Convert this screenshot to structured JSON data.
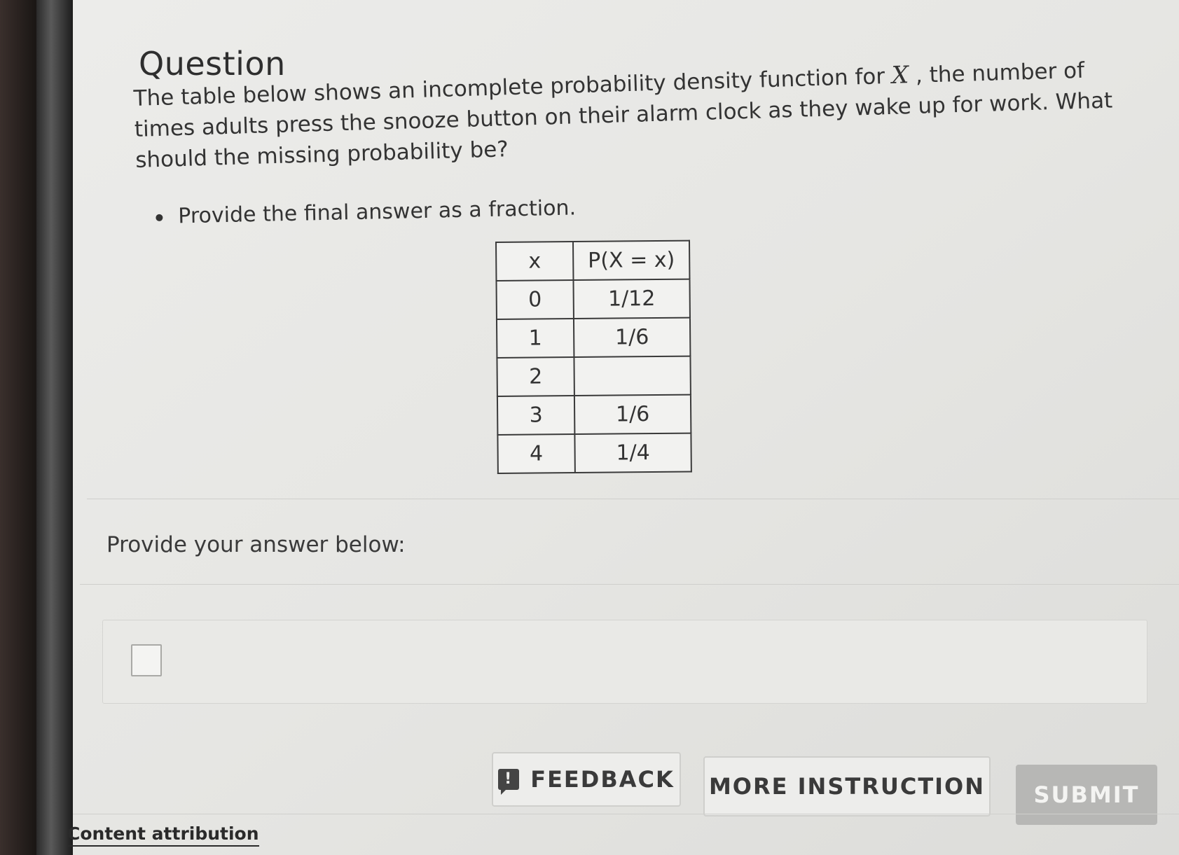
{
  "question": {
    "title": "Question",
    "text_before_var": "The table below shows an incomplete probability density function for ",
    "variable": "X",
    "text_after_var": " , the number of times adults press the snooze button on their alarm clock as they wake up for work. What should the missing probability be?",
    "bullets": [
      "Provide the final answer as a fraction."
    ]
  },
  "table": {
    "headers": [
      "x",
      "P(X = x)"
    ],
    "rows": [
      [
        "0",
        "1/12"
      ],
      [
        "1",
        "1/6"
      ],
      [
        "2",
        ""
      ],
      [
        "3",
        "1/6"
      ],
      [
        "4",
        "1/4"
      ]
    ]
  },
  "answer": {
    "prompt": "Provide your answer below:",
    "value": ""
  },
  "buttons": {
    "feedback": "FEEDBACK",
    "feedback_icon": "!",
    "more_instruction": "MORE INSTRUCTION",
    "submit": "SUBMIT"
  },
  "footer": {
    "attribution": "Content attribution"
  }
}
